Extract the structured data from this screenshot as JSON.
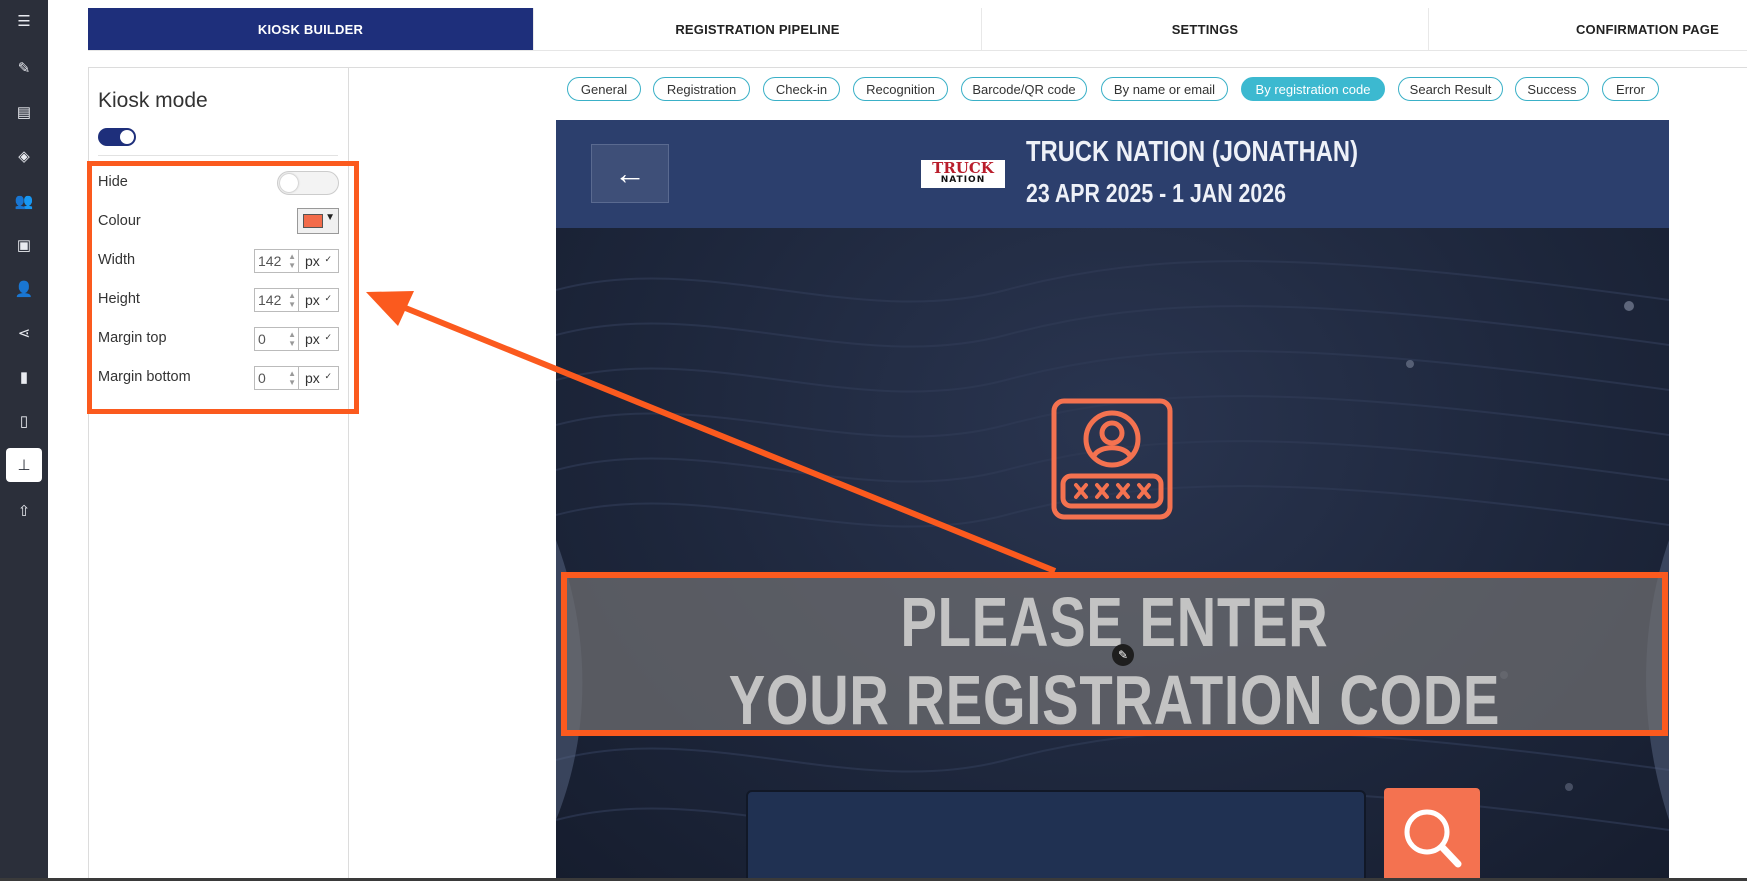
{
  "nav": {
    "items": [
      {
        "name": "menu-icon",
        "glyph": "☰"
      },
      {
        "name": "pencil-icon",
        "glyph": "✎"
      },
      {
        "name": "document-icon",
        "glyph": "▤"
      },
      {
        "name": "tag-icon",
        "glyph": "◈"
      },
      {
        "name": "group-icon",
        "glyph": "👥"
      },
      {
        "name": "briefcase-icon",
        "glyph": "▣"
      },
      {
        "name": "users-icon",
        "glyph": "👤"
      },
      {
        "name": "share-icon",
        "glyph": "⋖"
      },
      {
        "name": "bar-chart-icon",
        "glyph": "▮"
      },
      {
        "name": "page-icon",
        "glyph": "▯"
      },
      {
        "name": "kiosk-icon",
        "glyph": "⊥"
      },
      {
        "name": "upload-icon",
        "glyph": "⇧"
      }
    ]
  },
  "tabs": [
    {
      "label": "KIOSK BUILDER",
      "active": true
    },
    {
      "label": "REGISTRATION PIPELINE",
      "active": false
    },
    {
      "label": "SETTINGS",
      "active": false
    },
    {
      "label": "CONFIRMATION PAGE",
      "active": false
    }
  ],
  "panel": {
    "title": "Kiosk mode",
    "kiosk_mode_on": true,
    "hide_label": "Hide",
    "hide_on": false,
    "colour_label": "Colour",
    "colour_value": "#f26b4a",
    "width_label": "Width",
    "width_value": "142",
    "width_unit": "px",
    "height_label": "Height",
    "height_value": "142",
    "height_unit": "px",
    "margin_top_label": "Margin top",
    "margin_top_value": "0",
    "margin_top_unit": "px",
    "margin_bottom_label": "Margin bottom",
    "margin_bottom_value": "0",
    "margin_bottom_unit": "px"
  },
  "pills": [
    {
      "label": "General",
      "active": false
    },
    {
      "label": "Registration",
      "active": false
    },
    {
      "label": "Check-in",
      "active": false
    },
    {
      "label": "Recognition",
      "active": false
    },
    {
      "label": "Barcode/QR code",
      "active": false
    },
    {
      "label": "By name or email",
      "active": false
    },
    {
      "label": "By registration code",
      "active": true
    },
    {
      "label": "Search Result",
      "active": false
    },
    {
      "label": "Success",
      "active": false
    },
    {
      "label": "Error",
      "active": false
    }
  ],
  "preview": {
    "back_glyph": "←",
    "logo_top": "TRUCK",
    "logo_bottom": "NATION",
    "event_name": "TRUCK NATION (JONATHAN)",
    "event_dates": "23 APR 2025 - 1 JAN 2026",
    "headline_line1": "PLEASE ENTER",
    "headline_line2": "YOUR REGISTRATION CODE",
    "edit_glyph": "✎"
  },
  "colors": {
    "accent_navy": "#1e2f7b",
    "highlight_orange": "#fb5a1e",
    "pill_active": "#3cb9d0",
    "icon_orange": "#f47250"
  }
}
